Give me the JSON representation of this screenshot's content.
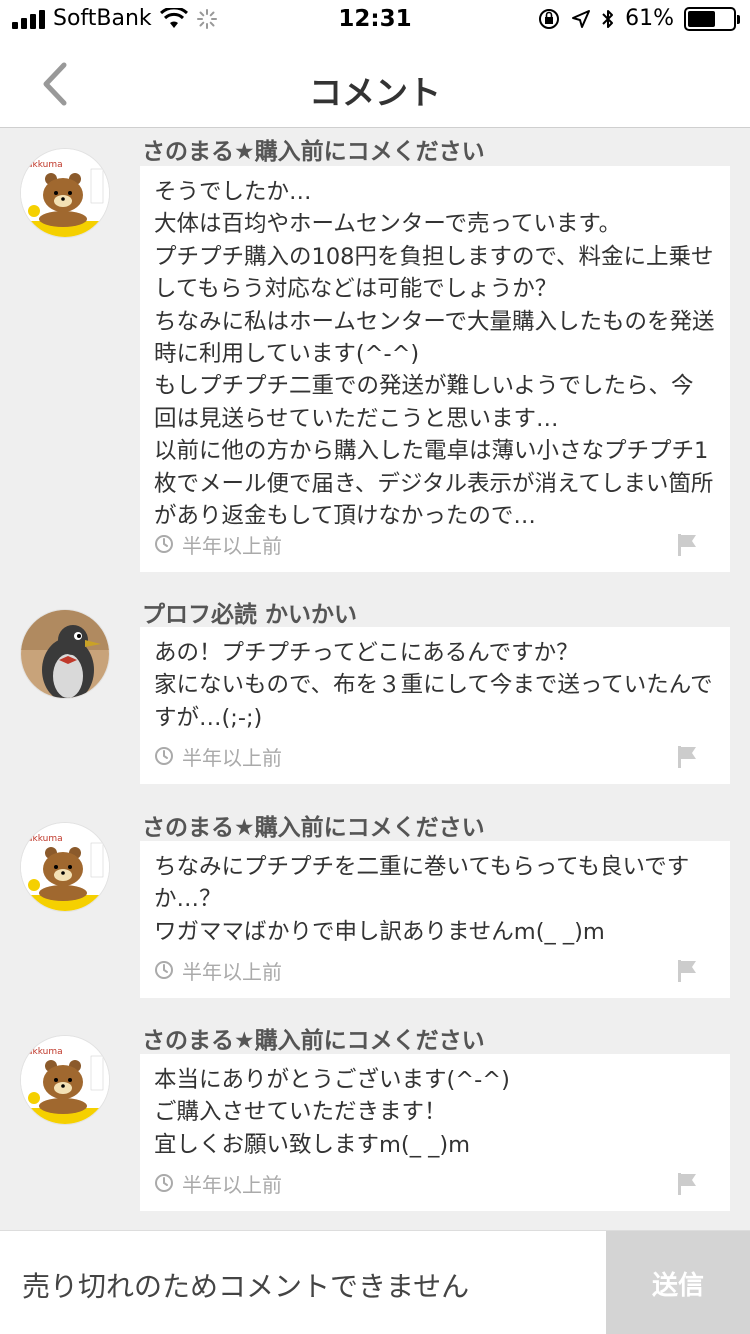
{
  "status_bar": {
    "carrier": "SoftBank",
    "time": "12:31",
    "battery": "61%"
  },
  "nav": {
    "title": "コメント"
  },
  "comments": [
    {
      "user": "さのまる★購入前にコメください",
      "text": "そうでしたか…\n大体は百均やホームセンターで売っています。\nプチプチ購入の108円を負担しますので、料金に上乗せしてもらう対応などは可能でしょうか？\nちなみに私はホームセンターで大量購入したものを発送時に利用しています(^-^)\nもしプチプチ二重での発送が難しいようでしたら、今回は見送らせていただこうと思います…\n以前に他の方から購入した電卓は薄い小さなプチプチ1枚でメール便で届き、デジタル表示が消えてしまい箇所があり返金もして頂けなかったので…",
      "time": "半年以上前"
    },
    {
      "user": "プロフ必読 かいかい",
      "text": "あの！プチプチってどこにあるんですか？\n家にないもので、布を３重にして今まで送っていたんですが…(;-;)",
      "time": "半年以上前"
    },
    {
      "user": "さのまる★購入前にコメください",
      "text": "ちなみにプチプチを二重に巻いてもらっても良いですか…？\nワガママばかりで申し訳ありませんm(_ _)m",
      "time": "半年以上前"
    },
    {
      "user": "さのまる★購入前にコメください",
      "text": "本当にありがとうございます(^-^)\nご購入させていただきます！\n宜しくお願い致しますm(_ _)m",
      "time": "半年以上前"
    }
  ],
  "avatar_logo_text": "akkuma",
  "input": {
    "placeholder": "売り切れのためコメントできません",
    "send_label": "送信"
  },
  "colors": {
    "background": "#efefef",
    "send_disabled": "#d4d4d4",
    "avatar_ring": "#f5d000"
  }
}
